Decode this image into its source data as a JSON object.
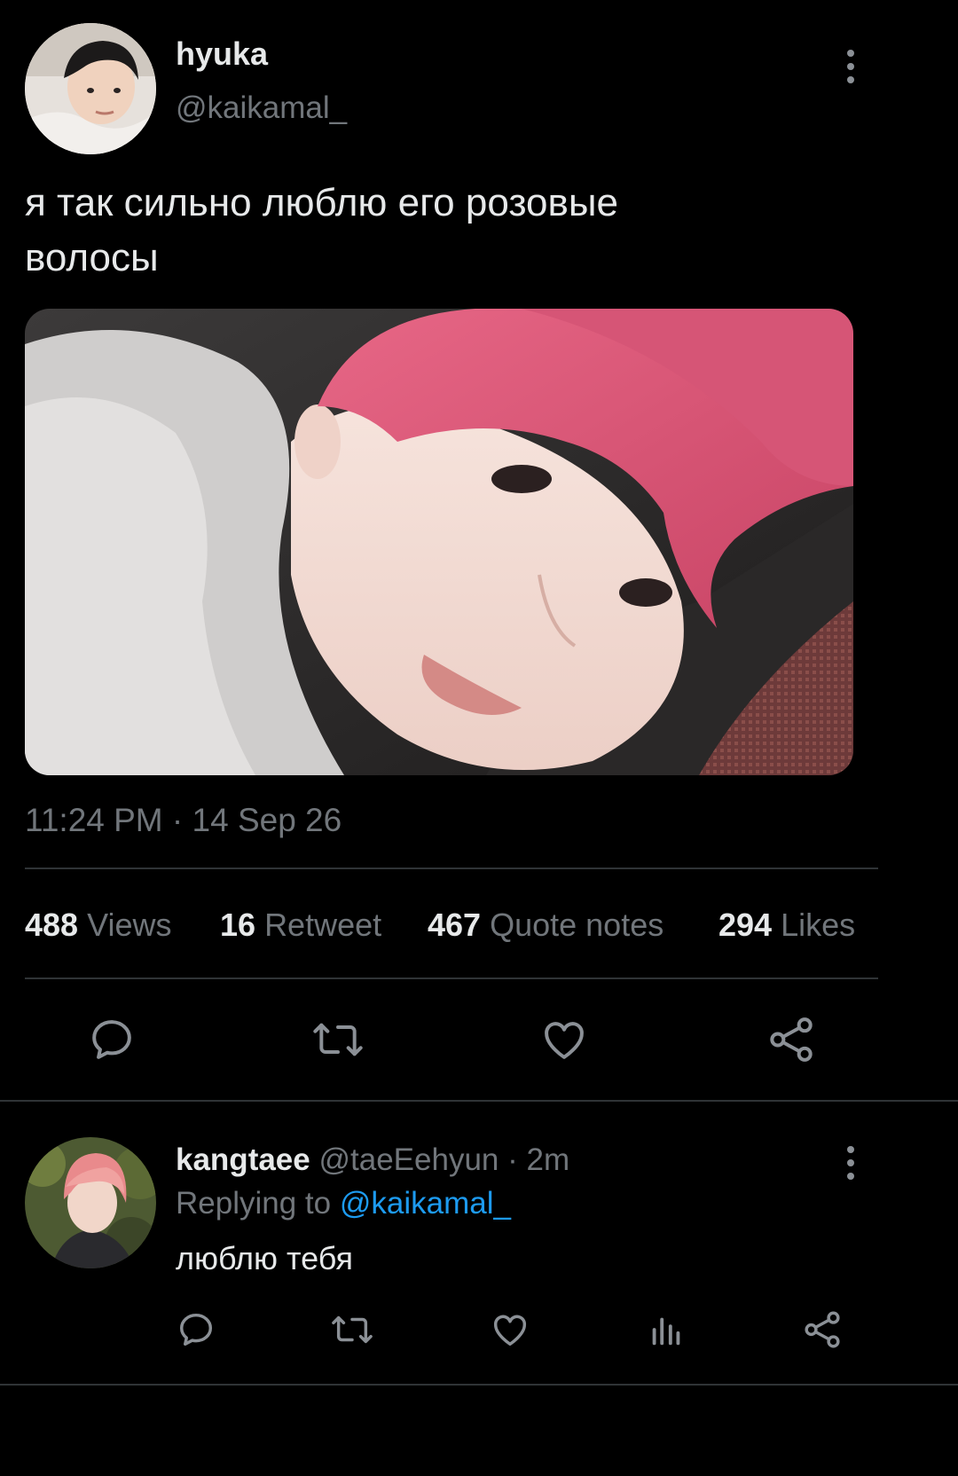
{
  "tweet": {
    "display_name": "hyuka",
    "handle": "@kaikamal_",
    "text_line1": "я так сильно люблю его розовые",
    "text_line2": "волосы",
    "timestamp": "11:24 PM · 14 Sep 26"
  },
  "stats": [
    {
      "count": "488",
      "label": "Views"
    },
    {
      "count": "16",
      "label": "Retweet"
    },
    {
      "count": "467",
      "label": "Quote notes"
    },
    {
      "count": "294",
      "label": "Likes"
    }
  ],
  "reply": {
    "display_name": "kangtaee",
    "handle": "@taeEehyun",
    "time": "· 2m",
    "replying_prefix": "Replying to",
    "replying_handle": "@kaikamal_",
    "text": "люблю тебя"
  },
  "icons": {
    "tweet_actions": [
      "reply-icon",
      "retweet-icon",
      "like-icon",
      "share-icon"
    ],
    "reply_actions": [
      "reply-icon",
      "retweet-icon",
      "like-icon",
      "views-icon",
      "share-icon"
    ],
    "more": "more-vertical-icon"
  },
  "colors": {
    "background": "#000000",
    "text": "#e7e9ea",
    "muted": "#71767b",
    "link": "#1d9bf0",
    "hair_pink": "#e0607e"
  }
}
